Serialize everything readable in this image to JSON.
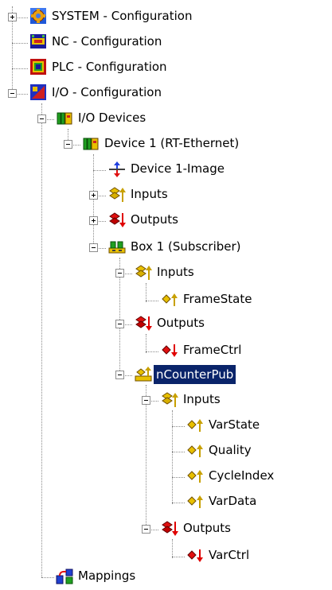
{
  "tree": {
    "system": {
      "label": "SYSTEM - Configuration",
      "icon": "system-config-icon"
    },
    "nc": {
      "label": "NC - Configuration",
      "icon": "nc-config-icon"
    },
    "plc": {
      "label": "PLC - Configuration",
      "icon": "plc-config-icon"
    },
    "io": {
      "label": "I/O - Configuration",
      "icon": "io-config-icon"
    },
    "io_devices": {
      "label": "I/O Devices",
      "icon": "io-devices-icon"
    },
    "device1": {
      "label": "Device 1 (RT-Ethernet)",
      "icon": "ethernet-device-icon"
    },
    "device1_image": {
      "label": "Device 1-Image",
      "icon": "process-image-icon"
    },
    "device1_inputs": {
      "label": "Inputs",
      "icon": "inputs-icon"
    },
    "device1_outputs": {
      "label": "Outputs",
      "icon": "outputs-icon"
    },
    "box1": {
      "label": "Box 1 (Subscriber)",
      "icon": "subscriber-box-icon"
    },
    "box1_inputs": {
      "label": "Inputs",
      "icon": "inputs-icon"
    },
    "framestate": {
      "label": "FrameState",
      "icon": "input-variable-icon"
    },
    "box1_outputs": {
      "label": "Outputs",
      "icon": "outputs-icon"
    },
    "framectrl": {
      "label": "FrameCtrl",
      "icon": "output-variable-icon"
    },
    "ncounterpub": {
      "label": "nCounterPub",
      "icon": "publisher-variable-icon",
      "selected": true
    },
    "nc_inputs": {
      "label": "Inputs",
      "icon": "inputs-icon"
    },
    "varstate": {
      "label": "VarState",
      "icon": "input-variable-icon"
    },
    "quality": {
      "label": "Quality",
      "icon": "input-variable-icon"
    },
    "cycleindex": {
      "label": "CycleIndex",
      "icon": "input-variable-icon"
    },
    "vardata": {
      "label": "VarData",
      "icon": "input-variable-icon"
    },
    "nc_outputs": {
      "label": "Outputs",
      "icon": "outputs-icon"
    },
    "varctrl": {
      "label": "VarCtrl",
      "icon": "output-variable-icon"
    },
    "mappings": {
      "label": "Mappings",
      "icon": "mappings-icon"
    }
  },
  "colors": {
    "selection_bg": "#0a246a",
    "selection_fg": "#ffffff",
    "input_arrow": "#c8a000",
    "output_arrow": "#e00000",
    "tree_line": "#8a8a8a"
  }
}
